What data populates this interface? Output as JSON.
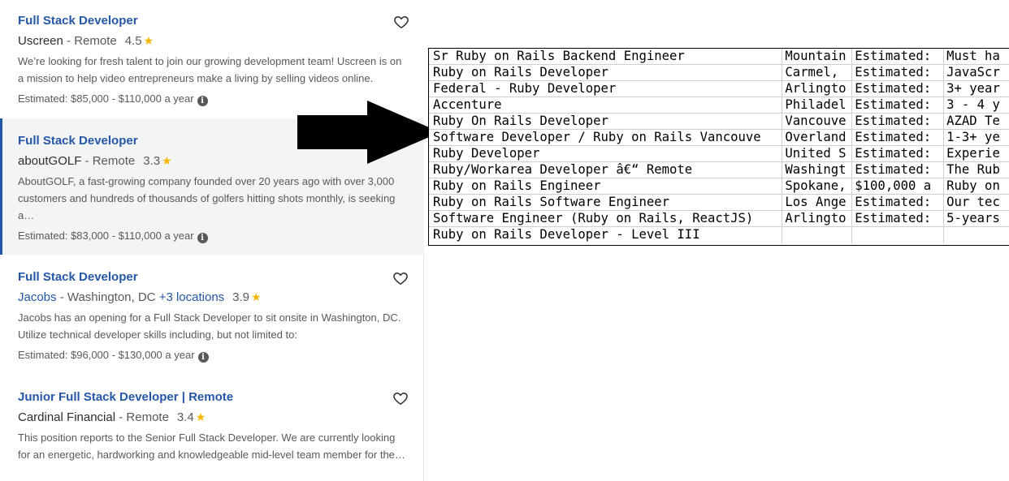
{
  "jobs": [
    {
      "title": "Full Stack Developer",
      "company": "Uscreen",
      "location": " - Remote",
      "more_locations": "",
      "rating": "4.5",
      "snippet": "We’re looking for fresh talent to join our growing development team! Uscreen is on a mission to help video entrepreneurs make a living by selling videos online.",
      "salary": "Estimated: $85,000 - $110,000 a year"
    },
    {
      "title": "Full Stack Developer",
      "company": "aboutGOLF",
      "location": " - Remote",
      "more_locations": "",
      "rating": "3.3",
      "snippet": "AboutGOLF, a fast-growing company founded over 20 years ago with over 3,000 customers and hundreds of thousands of golfers hitting shots monthly, is seeking a…",
      "salary": "Estimated: $83,000 - $110,000 a year"
    },
    {
      "title": "Full Stack Developer",
      "company": "Jacobs",
      "location": " - Washington, DC ",
      "more_locations": "+3 locations",
      "rating": "3.9",
      "snippet": "Jacobs has an opening for a Full Stack Developer to sit onsite in Washington, DC. Utilize technical developer skills including, but not limited to:",
      "salary": "Estimated: $96,000 - $130,000 a year"
    },
    {
      "title": "Junior Full Stack Developer | Remote",
      "company": "Cardinal Financial",
      "location": " - Remote",
      "more_locations": "",
      "rating": "3.4",
      "snippet": "This position reports to the Senior Full Stack Developer. We are currently looking for an energetic, hardworking and knowledgeable mid-level team member for the…",
      "salary": ""
    }
  ],
  "icons": {
    "heart": "heart-outline-icon",
    "star": "star-icon",
    "info": "info-icon",
    "arrow": "right-arrow"
  },
  "colors": {
    "link": "#2557a7",
    "star": "#f5b500",
    "selected_bg": "#f3f4f6"
  },
  "table": {
    "rows": [
      [
        "Sr Ruby on Rails Backend Engineer",
        "Mountain",
        "Estimated:",
        "Must ha"
      ],
      [
        "Ruby on Rails Developer",
        "Carmel,",
        "Estimated:",
        "JavaScr"
      ],
      [
        "Federal - Ruby Developer",
        "Arlingto",
        "Estimated:",
        "3+ year"
      ],
      [
        "Accenture",
        "Philadel",
        "Estimated:",
        "3 - 4 y"
      ],
      [
        "Ruby On Rails Developer",
        "Vancouve",
        "Estimated:",
        "AZAD Te"
      ],
      [
        "Software Developer / Ruby on Rails Vancouve",
        "Overland",
        "Estimated:",
        "1-3+ ye"
      ],
      [
        "Ruby Developer",
        "United S",
        "Estimated:",
        "Experie"
      ],
      [
        "Ruby/Workarea Developer â€“ Remote",
        "Washingt",
        "Estimated:",
        "The Rub"
      ],
      [
        "Ruby on Rails Engineer",
        "Spokane,",
        "$100,000 a",
        "Ruby on"
      ],
      [
        "Ruby on Rails Software Engineer",
        "Los Ange",
        "Estimated:",
        "Our tec"
      ],
      [
        "Software Engineer (Ruby on Rails, ReactJS)",
        "Arlingto",
        "Estimated:",
        "5-years"
      ],
      [
        "Ruby on Rails Developer - Level III",
        "",
        "",
        ""
      ]
    ]
  }
}
